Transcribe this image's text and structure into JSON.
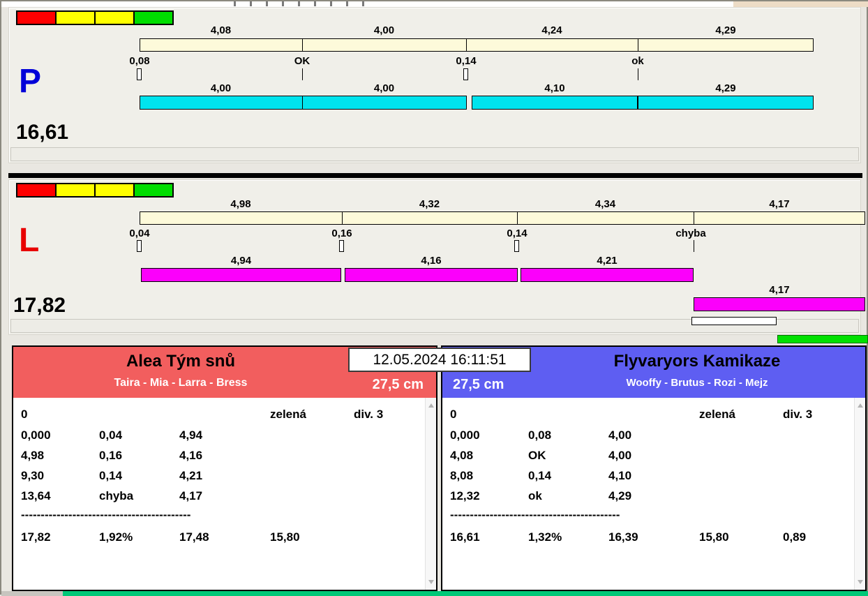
{
  "timestamp": "12.05.2024 16:11:51",
  "p": {
    "letter": "P",
    "total": "16,61",
    "splits": [
      "4,08",
      "4,00",
      "4,24",
      "4,29"
    ],
    "marks": [
      "0,08",
      "OK",
      "0,14",
      "ok"
    ],
    "runs": [
      "4,00",
      "4,00",
      "4,10",
      "4,29"
    ]
  },
  "l": {
    "letter": "L",
    "total": "17,82",
    "splits": [
      "4,98",
      "4,32",
      "4,34",
      "4,17"
    ],
    "marks": [
      "0,04",
      "0,16",
      "0,14",
      "chyba"
    ],
    "runs": [
      "4,94",
      "4,16",
      "4,21",
      "4,17"
    ]
  },
  "left_team": {
    "name": "Alea Tým snů",
    "members": "Taira - Mia - Larra - Bress",
    "category": "27,5 cm",
    "penalty": "0",
    "status": "zelená",
    "division": "div. 3",
    "rows": [
      [
        "0,000",
        "0,04",
        "4,94"
      ],
      [
        "4,98",
        "0,16",
        "4,16"
      ],
      [
        "9,30",
        "0,14",
        "4,21"
      ],
      [
        "13,64",
        "chyba",
        "4,17"
      ]
    ],
    "dashes": "-------------------------------------------",
    "summary": [
      "17,82",
      "1,92%",
      "17,48",
      "15,80"
    ]
  },
  "right_team": {
    "name": "Flyvaryors Kamikaze",
    "members": "Wooffy - Brutus - Rozi - Mejz",
    "category": "27,5 cm",
    "penalty": "0",
    "status": "zelená",
    "division": "div. 3",
    "rows": [
      [
        "0,000",
        "0,08",
        "4,00"
      ],
      [
        "4,08",
        "OK",
        "4,00"
      ],
      [
        "8,08",
        "0,14",
        "4,10"
      ],
      [
        "12,32",
        "ok",
        "4,29"
      ]
    ],
    "dashes": "-------------------------------------------",
    "summary": [
      "16,61",
      "1,32%",
      "16,39",
      "15,80",
      "0,89"
    ]
  },
  "colors": {
    "p_run_bar": "#00e4ee",
    "l_run_bar": "#fb00fb",
    "split_bar": "#fdfada",
    "left_header": "#f25e5e",
    "right_header": "#5e5ef2",
    "traffic_lights": [
      "#ff0000",
      "#ffff00",
      "#ffff00",
      "#00dd00"
    ],
    "bottom_bar_green": "#00c878"
  }
}
